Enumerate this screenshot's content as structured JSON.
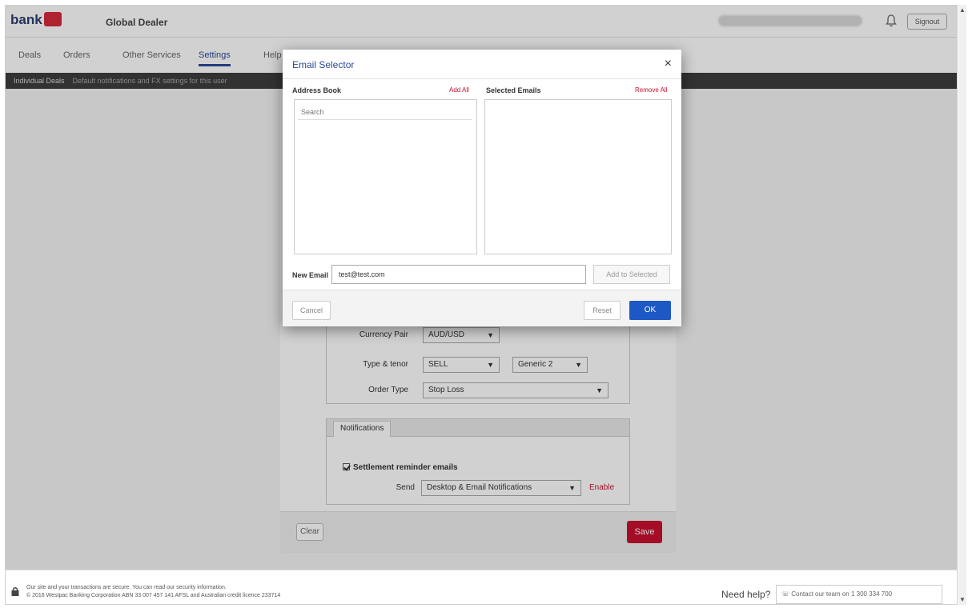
{
  "header": {
    "brand": "bank",
    "app_title": "Global Dealer",
    "signout_label": "Signout"
  },
  "tabs": [
    {
      "label": "Deals"
    },
    {
      "label": "Orders"
    },
    {
      "label": "Other Services"
    },
    {
      "label": "Settings"
    },
    {
      "label": "Help"
    }
  ],
  "strip": {
    "title": "Individual Deals",
    "detail": "Default notifications and FX settings for this user"
  },
  "settings": {
    "currency_pair_label": "Currency Pair",
    "currency_pair_value": "AUD/USD",
    "type_tenor_label": "Type & tenor",
    "type_value": "SELL",
    "tenor_value": "Generic 2",
    "order_type_label": "Order Type",
    "order_type_value": "Stop Loss"
  },
  "notifications": {
    "tab_label": "Notifications",
    "checkbox_label": "Settlement reminder emails",
    "send_label": "Send",
    "send_value": "Desktop & Email Notifications",
    "enable_link": "Enable"
  },
  "panel_footer": {
    "clear_label": "Clear",
    "save_label": "Save"
  },
  "modal": {
    "title": "Email Selector",
    "close_glyph": "×",
    "address_book_label": "Address Book",
    "add_all_label": "Add All",
    "selected_emails_label": "Selected Emails",
    "remove_all_label": "Remove All",
    "search_placeholder": "Search",
    "new_email_label": "New Email",
    "new_email_value": "test@test.com",
    "add_to_selected_label": "Add to Selected",
    "cancel_label": "Cancel",
    "reset_label": "Reset",
    "ok_label": "OK"
  },
  "footer": {
    "line1": "Our site and your transactions are secure. You can read our security information.",
    "line2": "© 2016 Westpac Banking Corporation ABN 33 007 457 141 AFSL and Australian credit licence 233714",
    "need_help": "Need help?",
    "phone": "Contact our team on 1 300 334 700"
  },
  "colors": {
    "brand_blue": "#2d4a9a",
    "brand_red": "#c8102e",
    "ok_blue": "#1e58c4"
  }
}
